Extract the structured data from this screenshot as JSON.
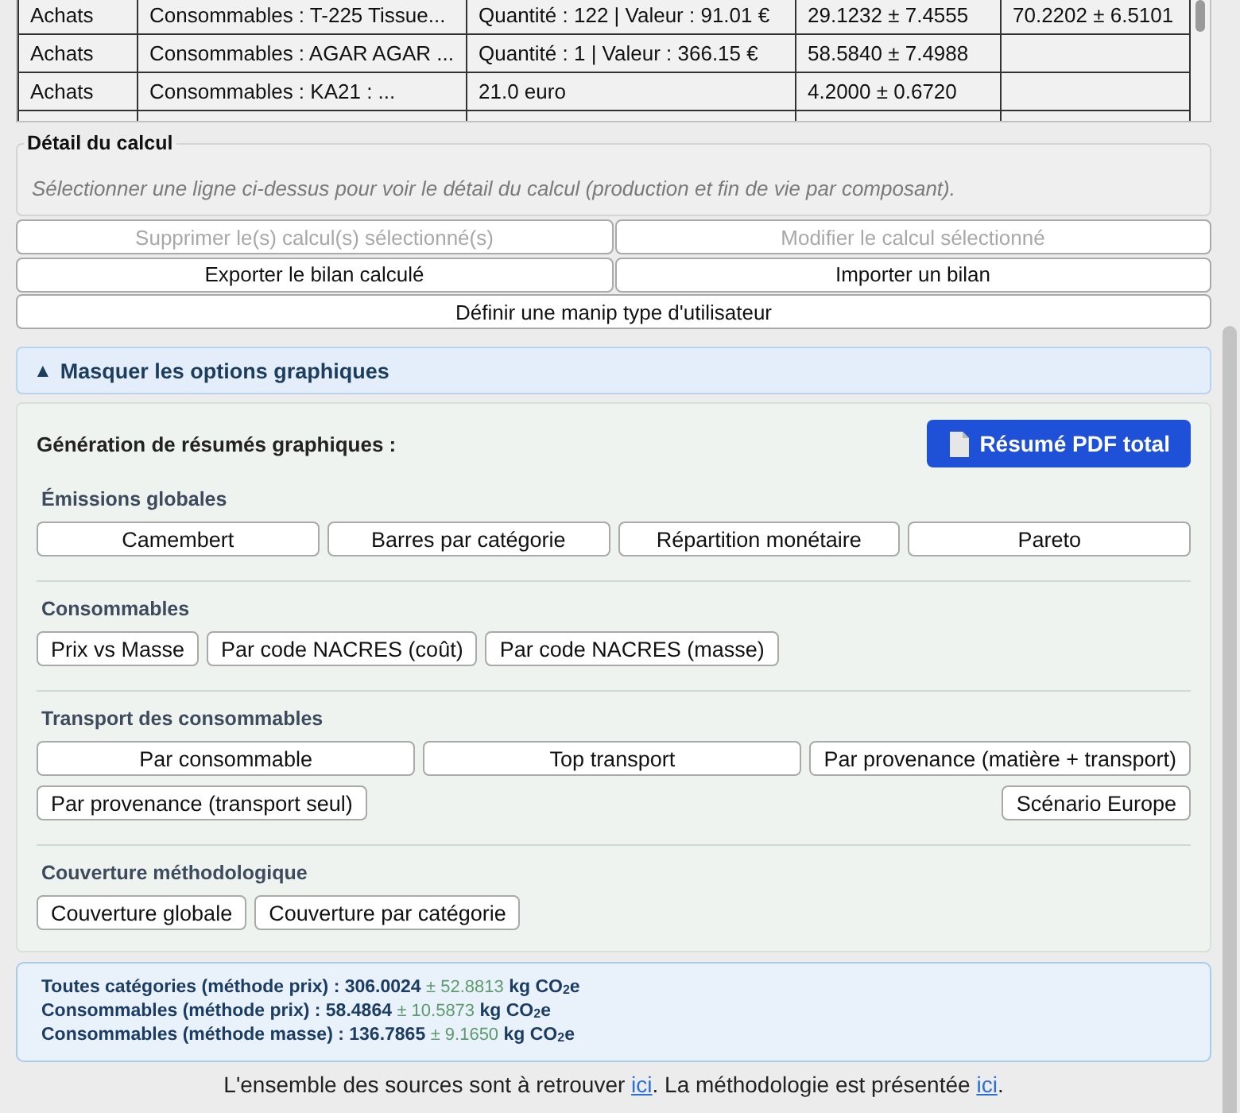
{
  "table": {
    "rows": [
      {
        "column_1": "Achats",
        "column_2": "Consommables : T-225 Tissue...",
        "column_3": "Quantité : 122 | Valeur : 91.01 €",
        "column_4": "29.1232 ± 7.4555",
        "column_5": "70.2202 ± 6.5101"
      },
      {
        "column_1": "Achats",
        "column_2": "Consommables : AGAR AGAR ...",
        "column_3": "Quantité : 1 | Valeur : 366.15 €",
        "column_4": "58.5840 ± 7.4988"
      },
      {
        "column_1": "Achats",
        "column_2": "Consommables : KA21 : ...",
        "column_3": "21.0 euro",
        "column_4": "4.2000 ± 0.6720"
      }
    ]
  },
  "detail": {
    "title": "Détail du calcul",
    "hint": "Sélectionner une ligne ci-dessus pour voir le détail du calcul (production et fin de vie par composant)."
  },
  "actions": [
    {
      "label": "Supprimer le(s) calcul(s) sélectionné(s)",
      "disabled": true
    },
    {
      "label": "Modifier le calcul sélectionné",
      "disabled": true
    },
    {
      "label": "Exporter le bilan calculé",
      "disabled": false
    },
    {
      "label": "Importer un bilan",
      "disabled": false
    },
    {
      "label": "Définir une manip type d'utilisateur",
      "disabled": false
    }
  ],
  "graph_options": {
    "toggle": {
      "arrow": "▲",
      "label": "Masquer les options graphiques"
    },
    "title": "Génération de résumés graphiques :",
    "pdf_button": "Résumé PDF total",
    "sections": [
      {
        "title": "Émissions globales",
        "buttons": [
          "Camembert",
          "Barres par catégorie",
          "Répartition monétaire",
          "Pareto"
        ]
      },
      {
        "title": "Consommables",
        "buttons": [
          "Prix vs Masse",
          "Par code NACRES (coût)",
          "Par code NACRES (masse)"
        ]
      },
      {
        "title": "Transport des consommables",
        "buttons": [
          "Par consommable",
          "Top transport",
          "Par provenance (matière + transport)",
          "Par provenance (transport seul)",
          "Scénario Europe"
        ]
      },
      {
        "title": "Couverture méthodologique",
        "buttons": [
          "Couverture globale",
          "Couverture par catégorie"
        ]
      }
    ]
  },
  "summary": [
    {
      "label": "Toutes catégories (méthode prix) : 306.0024",
      "uncertainty": "± 52.8813",
      "unit": "kg CO$_{2}$e"
    },
    {
      "label": "Consommables (méthode prix) : 58.4864",
      "uncertainty": "± 10.5873",
      "unit": "kg CO$_{2}$e"
    },
    {
      "label": "Consommables (méthode masse) : 136.7865",
      "uncertainty": "± 9.1650",
      "unit": "kg CO$_{2}$e"
    }
  ],
  "footer": [
    {
      "kind": "text",
      "text": "L'ensemble des sources sont à retrouver "
    },
    {
      "kind": "link",
      "text": "ici"
    },
    {
      "kind": "text",
      "text": ". La méthodologie est présentée "
    },
    {
      "kind": "link",
      "text": "ici"
    },
    {
      "kind": "text",
      "text": "."
    }
  ]
}
